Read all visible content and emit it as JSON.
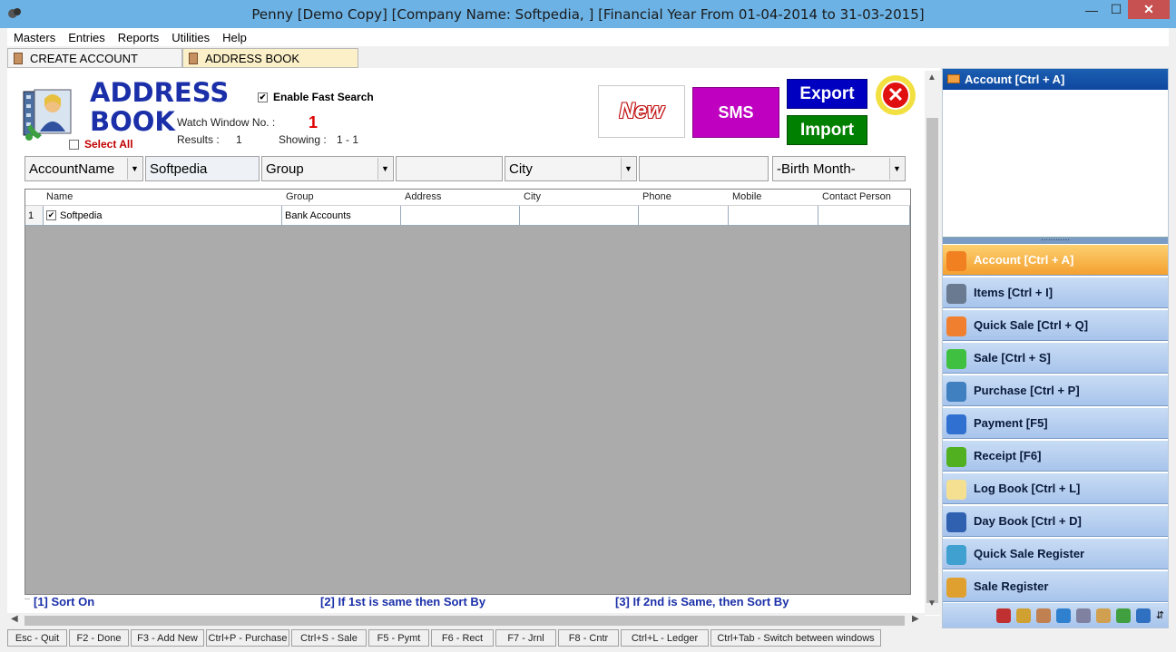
{
  "window": {
    "title": "Penny [Demo Copy] [Company Name: Softpedia, ] [Financial Year From 01-04-2014 to 31-03-2015]",
    "min": "—",
    "max": "☐",
    "close": "✕"
  },
  "menu": [
    "Masters",
    "Entries",
    "Reports",
    "Utilities",
    "Help"
  ],
  "tabs": [
    "CREATE ACCOUNT",
    "ADDRESS BOOK"
  ],
  "address_book": {
    "title_line1": "ADDRESS",
    "title_line2": "BOOK",
    "select_all": "Select All",
    "enable_fast_search": "Enable Fast Search",
    "fast_search_checked": "✔",
    "watch_window_label": "Watch Window No. :",
    "watch_window_value": "1",
    "results_label": "Results :",
    "results_value": "1",
    "showing_label": "Showing :",
    "showing_value": "1 - 1",
    "new_label": "New",
    "sms_label": "SMS",
    "export_label": "Export",
    "import_label": "Import",
    "close_label": "✕"
  },
  "filters": {
    "field": "AccountName",
    "value": "Softpedia",
    "group": "Group",
    "blank1": "",
    "city": "City",
    "blank2": "",
    "birth_month": "-Birth Month-",
    "dropdown_arrow": "▼"
  },
  "grid": {
    "headers": [
      "Name",
      "Group",
      "Address",
      "City",
      "Phone",
      "Mobile",
      "Contact Person"
    ],
    "rows": [
      {
        "num": "1",
        "checked": "✔",
        "name": "Softpedia",
        "group": "Bank Accounts",
        "address": "",
        "city": "",
        "phone": "",
        "mobile": "",
        "contact": ""
      }
    ]
  },
  "sort": {
    "s1": "[1] Sort On",
    "s2": "[2]  If 1st is same then Sort By",
    "s3": "[3] If 2nd is Same, then Sort By"
  },
  "status": [
    "Esc - Quit",
    "F2 - Done",
    "F3 - Add New",
    "Ctrl+P - Purchase",
    "Ctrl+S - Sale",
    "F5 - Pymt",
    "F6 - Rect",
    "F7 - Jrnl",
    "F8 - Cntr",
    "Ctrl+L - Ledger",
    "Ctrl+Tab - Switch between windows"
  ],
  "side": {
    "header": "Account [Ctrl + A]",
    "grip": "⋯⋯⋯⋯",
    "buttons": [
      "Account [Ctrl + A]",
      "Items [Ctrl + I]",
      "Quick Sale [Ctrl + Q]",
      "Sale [Ctrl + S]",
      "Purchase [Ctrl + P]",
      "Payment [F5]",
      "Receipt [F6]",
      "Log Book [Ctrl + L]",
      "Day Book [Ctrl + D]",
      "Quick Sale Register",
      "Sale Register"
    ],
    "button_colors": [
      "#f08020",
      "#6a7a90",
      "#f08030",
      "#40c040",
      "#4080c0",
      "#3070d0",
      "#50b020",
      "#f4e090",
      "#3060b0",
      "#40a0d0",
      "#e0a030"
    ],
    "toolbar_icons": [
      "user-icon",
      "search-icon",
      "book-icon",
      "home-icon",
      "people-icon",
      "pencil-icon",
      "recycle-icon",
      "globe-icon"
    ],
    "toolbar_colors": [
      "#c03030",
      "#d0a030",
      "#c08050",
      "#3080d0",
      "#8080a0",
      "#d0a050",
      "#40a040",
      "#3070c0"
    ],
    "overflow": "⇵"
  },
  "scroll": {
    "up": "▲",
    "down": "▼",
    "left": "◀",
    "right": "▶"
  }
}
